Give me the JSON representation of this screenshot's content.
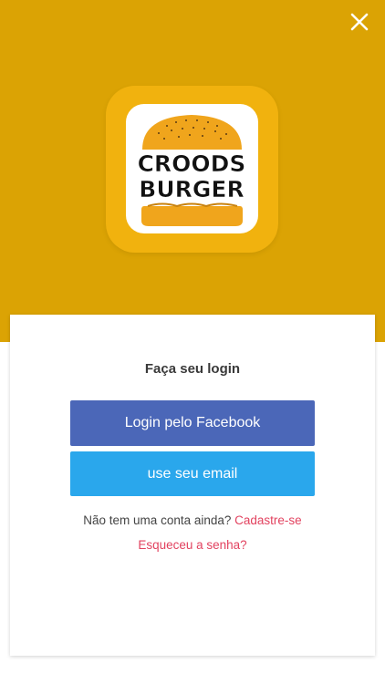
{
  "colors": {
    "header_background": "#DBA304",
    "logo_tile": "#F1B20E",
    "facebook_button": "#4B67B8",
    "email_button": "#2AA7EC",
    "link": "#E2425F"
  },
  "header": {
    "close_icon": "close-icon"
  },
  "logo": {
    "line1": "CROODS",
    "line2": "BURGER"
  },
  "login": {
    "title": "Faça seu login",
    "facebook_button_label": "Login pelo Facebook",
    "email_button_label": "use seu email",
    "signup_prompt": "Não tem uma conta ainda?",
    "signup_link": "Cadastre-se",
    "forgot_password_link": "Esqueceu a senha?"
  }
}
